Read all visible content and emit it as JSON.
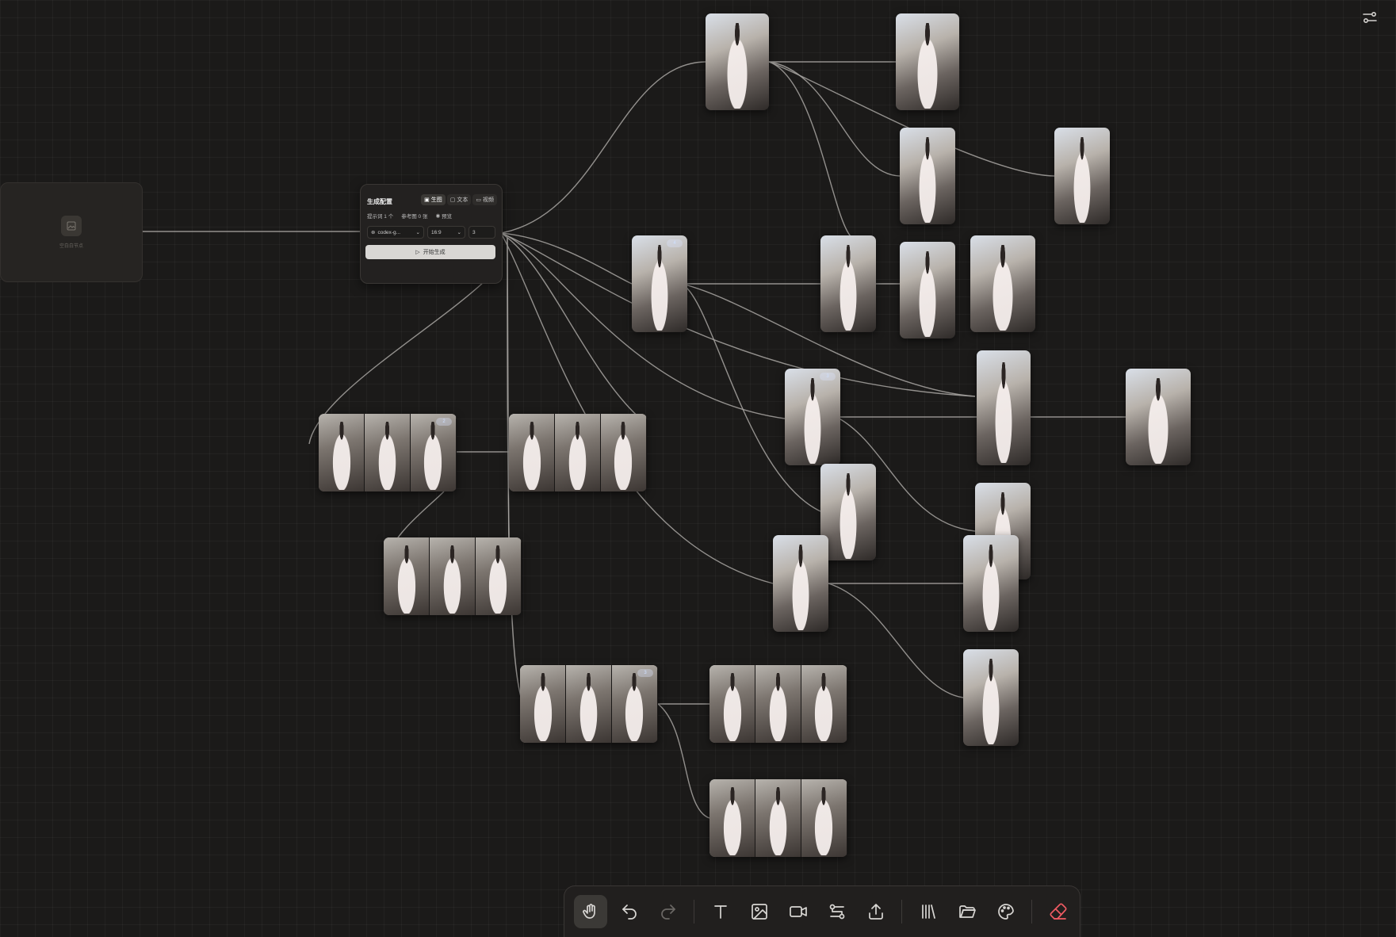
{
  "empty_node": {
    "placeholder": "空白白节点"
  },
  "gen_card": {
    "title": "生成配置",
    "modes": [
      {
        "label": "生图",
        "icon": "image-icon",
        "active": true
      },
      {
        "label": "文本",
        "icon": "text-icon",
        "active": false
      },
      {
        "label": "视频",
        "icon": "video-icon",
        "active": false
      }
    ],
    "prompt_count": "提示词 1 个",
    "ref_count": "参考图 0 张",
    "preview": "预览",
    "model": "codex-g...",
    "ratio": "16:9",
    "count": "3",
    "run_label": "开始生成"
  },
  "badges": {
    "b1": "4",
    "b2": "3",
    "b3": "2",
    "b4": "3"
  },
  "toolbar": {
    "items": [
      "hand-icon",
      "undo-icon",
      "redo-icon",
      "text-tool-icon",
      "image-tool-icon",
      "video-tool-icon",
      "connector-icon",
      "upload-icon",
      "library-icon",
      "folder-icon",
      "palette-icon",
      "eraser-icon"
    ]
  },
  "top_right": {
    "icon": "settings-sliders-icon"
  }
}
